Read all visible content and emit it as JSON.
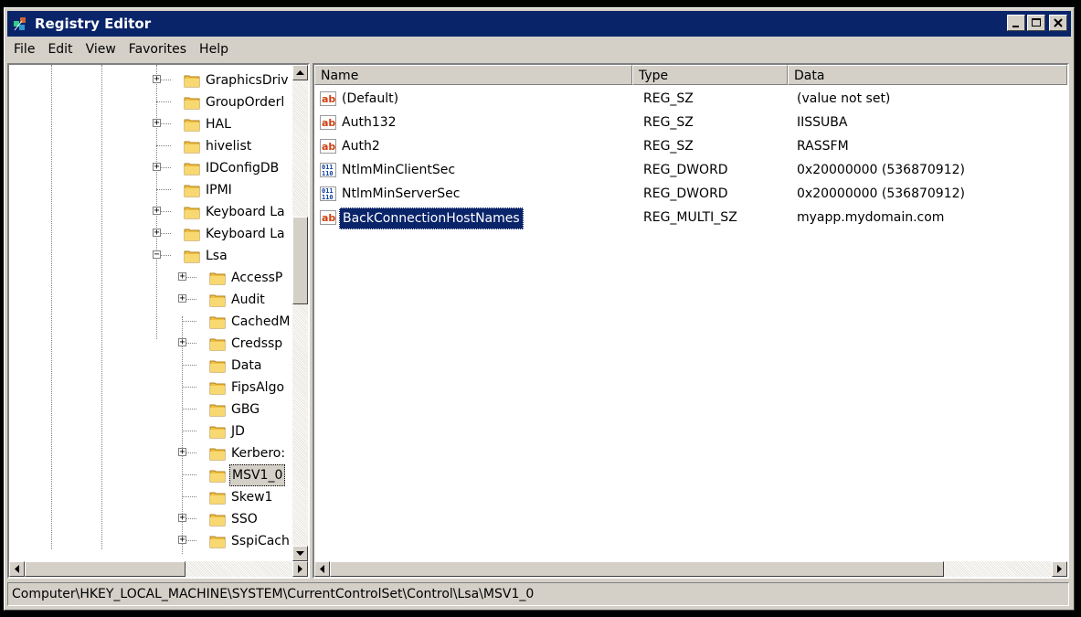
{
  "window": {
    "title": "Registry Editor"
  },
  "menu": [
    "File",
    "Edit",
    "View",
    "Favorites",
    "Help"
  ],
  "tree": {
    "items": [
      {
        "label": "GraphicsDriv",
        "expandable": true,
        "depth": 0
      },
      {
        "label": "GroupOrderl",
        "expandable": false,
        "depth": 0
      },
      {
        "label": "HAL",
        "expandable": true,
        "depth": 0
      },
      {
        "label": "hivelist",
        "expandable": false,
        "depth": 0
      },
      {
        "label": "IDConfigDB",
        "expandable": true,
        "depth": 0
      },
      {
        "label": "IPMI",
        "expandable": false,
        "depth": 0
      },
      {
        "label": "Keyboard La",
        "expandable": true,
        "depth": 0
      },
      {
        "label": "Keyboard La",
        "expandable": true,
        "depth": 0
      },
      {
        "label": "Lsa",
        "expandable": true,
        "expanded": true,
        "depth": 0
      },
      {
        "label": "AccessP",
        "expandable": true,
        "depth": 1
      },
      {
        "label": "Audit",
        "expandable": true,
        "depth": 1
      },
      {
        "label": "CachedM",
        "expandable": false,
        "depth": 1
      },
      {
        "label": "Credssp",
        "expandable": true,
        "depth": 1
      },
      {
        "label": "Data",
        "expandable": false,
        "depth": 1
      },
      {
        "label": "FipsAlgo",
        "expandable": false,
        "depth": 1
      },
      {
        "label": "GBG",
        "expandable": false,
        "depth": 1
      },
      {
        "label": "JD",
        "expandable": false,
        "depth": 1
      },
      {
        "label": "Kerbero:",
        "expandable": true,
        "depth": 1
      },
      {
        "label": "MSV1_0",
        "expandable": false,
        "depth": 1,
        "selected": true
      },
      {
        "label": "Skew1",
        "expandable": false,
        "depth": 1
      },
      {
        "label": "SSO",
        "expandable": true,
        "depth": 1
      },
      {
        "label": "SspiCach",
        "expandable": true,
        "depth": 1
      }
    ]
  },
  "list": {
    "columns": [
      "Name",
      "Type",
      "Data"
    ],
    "rows": [
      {
        "icon": "string-value-icon",
        "name": "(Default)",
        "type": "REG_SZ",
        "data": "(value not set)"
      },
      {
        "icon": "string-value-icon",
        "name": "Auth132",
        "type": "REG_SZ",
        "data": "IISSUBA"
      },
      {
        "icon": "string-value-icon",
        "name": "Auth2",
        "type": "REG_SZ",
        "data": "RASSFM"
      },
      {
        "icon": "binary-value-icon",
        "name": "NtlmMinClientSec",
        "type": "REG_DWORD",
        "data": "0x20000000 (536870912)"
      },
      {
        "icon": "binary-value-icon",
        "name": "NtlmMinServerSec",
        "type": "REG_DWORD",
        "data": "0x20000000 (536870912)"
      },
      {
        "icon": "string-value-icon",
        "name": "BackConnectionHostNames",
        "type": "REG_MULTI_SZ",
        "data": "myapp.mydomain.com",
        "selected": true
      }
    ]
  },
  "status": {
    "path": "Computer\\HKEY_LOCAL_MACHINE\\SYSTEM\\CurrentControlSet\\Control\\Lsa\\MSV1_0"
  }
}
